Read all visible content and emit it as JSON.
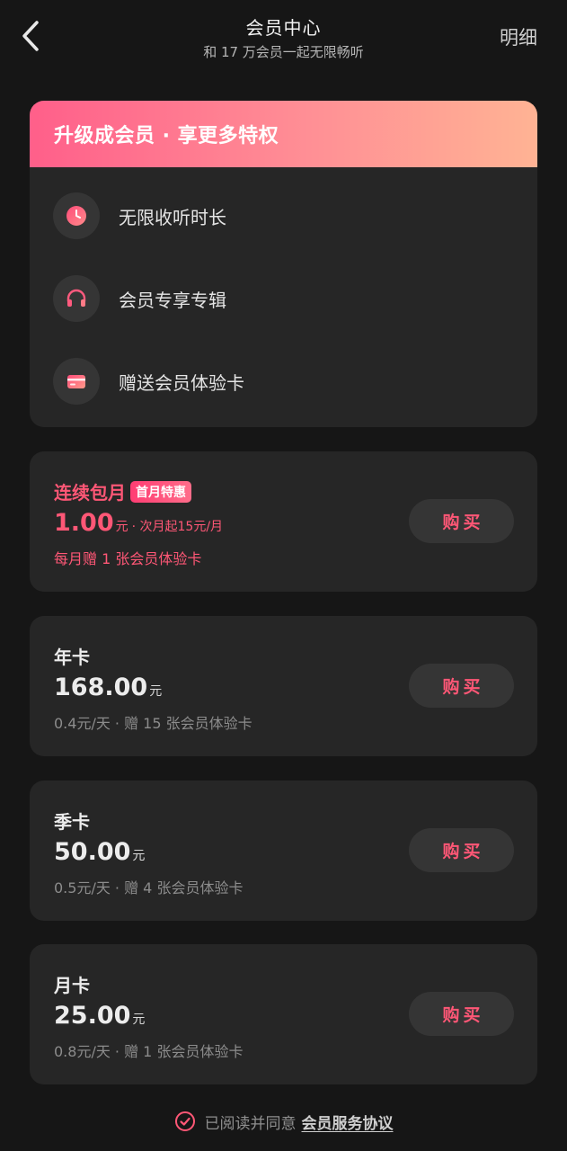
{
  "header": {
    "title": "会员中心",
    "subtitle": "和 17 万会员一起无限畅听",
    "detail_label": "明细"
  },
  "benefits": {
    "heading": "升级成会员 · 享更多特权",
    "items": [
      {
        "label": "无限收听时长",
        "icon": "clock-icon"
      },
      {
        "label": "会员专享专辑",
        "icon": "headphones-icon"
      },
      {
        "label": "赠送会员体验卡",
        "icon": "card-icon"
      }
    ]
  },
  "plans": [
    {
      "name": "连续包月",
      "badge": "首月特惠",
      "price": "1.00",
      "unit": "元",
      "price_note": "· 次月起15元/月",
      "desc": "每月赠 1 张会员体验卡",
      "buy_label": "购买"
    },
    {
      "name": "年卡",
      "price": "168.00",
      "unit": "元",
      "desc": "0.4元/天 · 赠 15 张会员体验卡",
      "buy_label": "购买"
    },
    {
      "name": "季卡",
      "price": "50.00",
      "unit": "元",
      "desc": "0.5元/天 · 赠 4 张会员体验卡",
      "buy_label": "购买"
    },
    {
      "name": "月卡",
      "price": "25.00",
      "unit": "元",
      "desc": "0.8元/天 · 赠 1 张会员体验卡",
      "buy_label": "购买"
    }
  ],
  "agreement": {
    "prefix": "已阅读并同意",
    "link": "会员服务协议",
    "checked": true
  },
  "colors": {
    "background": "#161616",
    "card": "#262626",
    "accent": "#ff5776",
    "gradient_start": "#ff5f8a",
    "gradient_end": "#ffb394"
  }
}
